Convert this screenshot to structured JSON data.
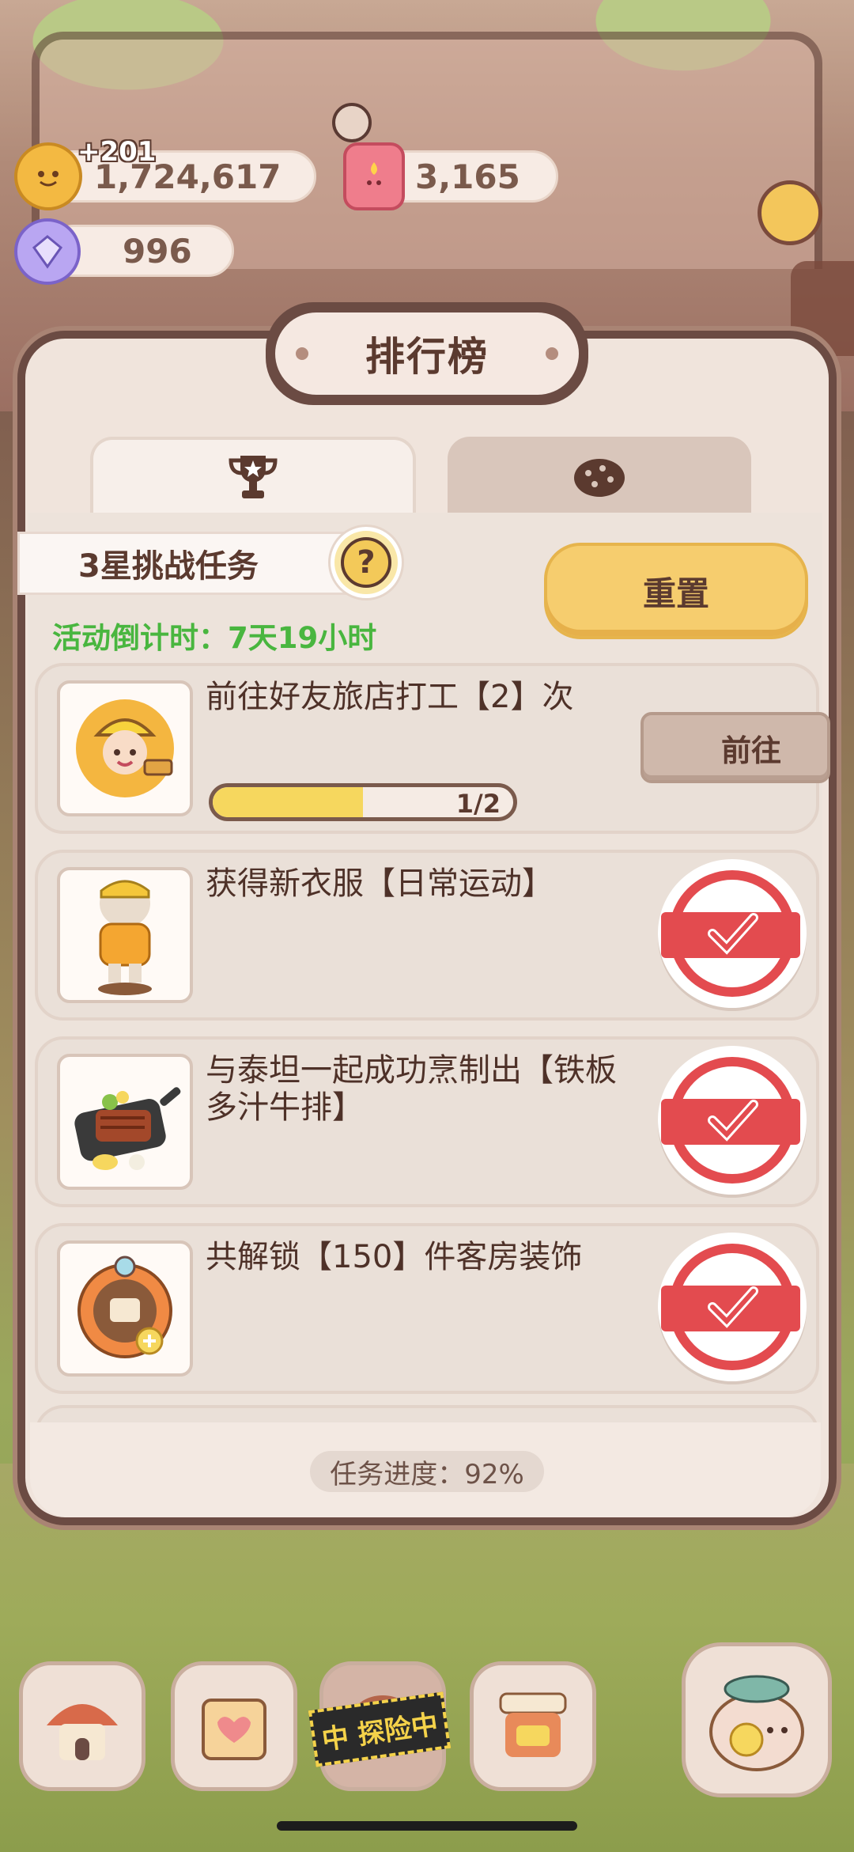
{
  "resources": {
    "coins": "1,724,617",
    "coins_gain": "+201",
    "candles": "3,165",
    "gems": "996"
  },
  "panel": {
    "title": "排行榜",
    "tabs": [
      {
        "name": "trophy-tab",
        "icon": "trophy-icon",
        "active": true
      },
      {
        "name": "cookie-tab",
        "icon": "cookie-icon",
        "active": false
      }
    ],
    "task_header": "3星挑战任务",
    "help_label": "?",
    "countdown": "活动倒计时：7天19小时",
    "reset_label": "重置",
    "tasks": [
      {
        "text": "前往好友旅店打工【2】次",
        "icon": "worker-character-icon",
        "progress": 0.5,
        "progress_label": "1/2",
        "action_label": "前往",
        "completed": false
      },
      {
        "text": "获得新衣服【日常运动】",
        "icon": "outfit-icon",
        "completed": true
      },
      {
        "text": "与泰坦一起成功烹制出【铁板多汁牛排】",
        "icon": "steak-dish-icon",
        "completed": true
      },
      {
        "text": "共解锁【150】件客房装饰",
        "icon": "decoration-icon",
        "completed": true
      }
    ],
    "overall_progress": "任务进度：92%"
  },
  "nav": {
    "banner": "中 探险中",
    "items": [
      "house-icon",
      "calendar-icon",
      "adventure-icon",
      "furniture-icon",
      "fish-clock-icon"
    ]
  },
  "colors": {
    "countdown_green": "#49b63f",
    "reset_yellow": "#f6cd6e",
    "stamp_red": "#e34b4f",
    "frame_brown": "#6b4b43"
  }
}
